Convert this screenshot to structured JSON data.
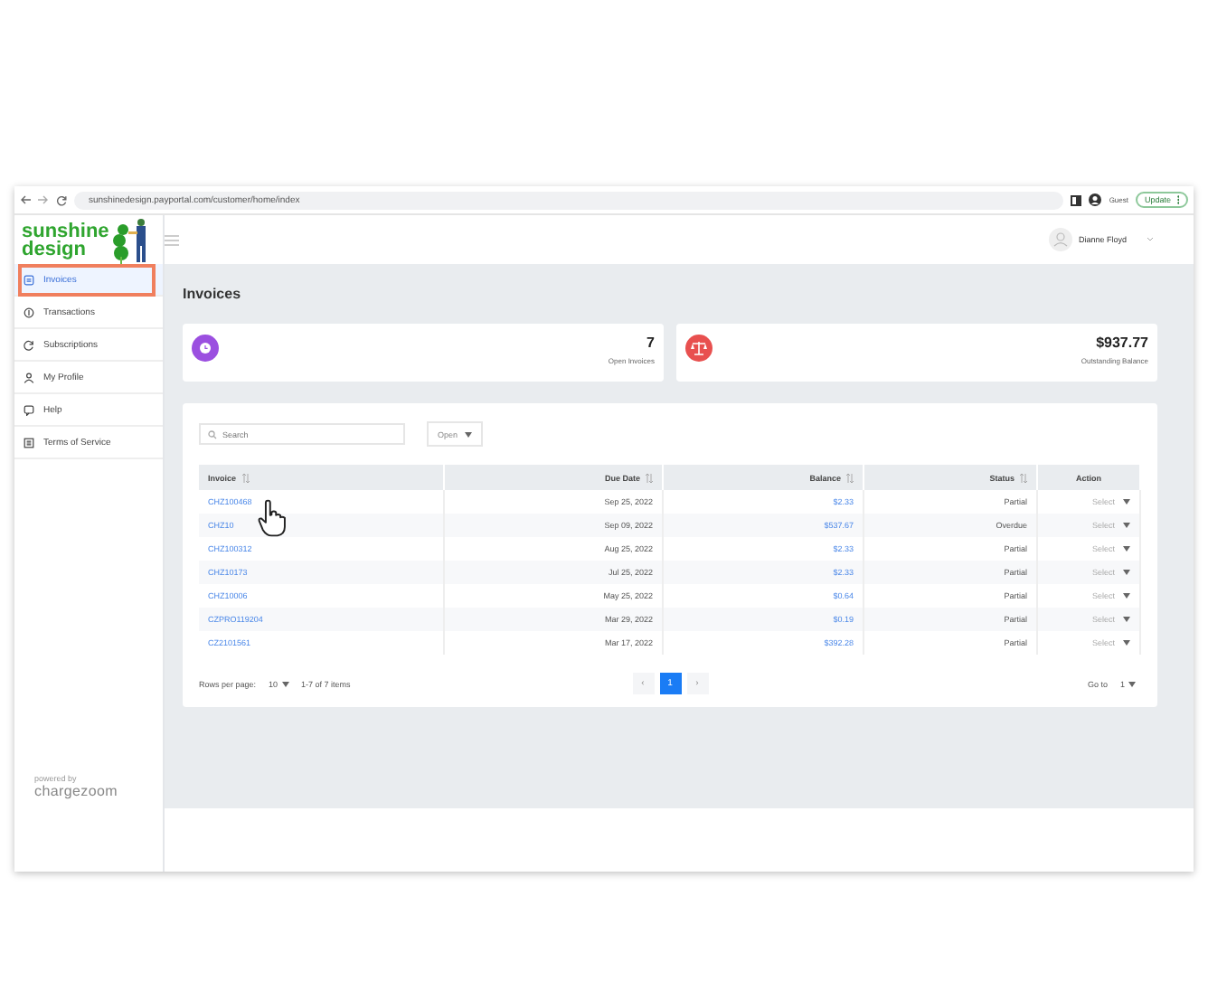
{
  "browser": {
    "url": "sunshinedesign.payportal.com/customer/home/index",
    "profile": "Guest",
    "update_button": "Update"
  },
  "logo": {
    "line1": "sunshine",
    "line2": "design"
  },
  "sidebar": {
    "items": [
      {
        "label": "Invoices",
        "selected": true
      },
      {
        "label": "Transactions",
        "selected": false
      },
      {
        "label": "Subscriptions",
        "selected": false
      },
      {
        "label": "My Profile",
        "selected": false
      },
      {
        "label": "Help",
        "selected": false
      },
      {
        "label": "Terms of Service",
        "selected": false
      }
    ],
    "powered_by": "powered by",
    "brand": "chargezoom"
  },
  "header": {
    "user": "Dianne Floyd"
  },
  "page_title": "Invoices",
  "stats": [
    {
      "value": "7",
      "label": "Open Invoices",
      "color": "#9b4fe0"
    },
    {
      "value": "$937.77",
      "label": "Outstanding Balance",
      "color": "#e8504f"
    }
  ],
  "filters": {
    "search_placeholder": "Search",
    "status": "Open"
  },
  "table": {
    "columns": [
      {
        "label": "Invoice",
        "sortable": true
      },
      {
        "label": "Due Date",
        "sortable": true
      },
      {
        "label": "Balance",
        "sortable": true
      },
      {
        "label": "Status",
        "sortable": true
      },
      {
        "label": "Action",
        "sortable": false
      }
    ],
    "rows": [
      {
        "invoice": "CHZ100468",
        "due_date": "Sep 25, 2022",
        "balance": "$2.33",
        "status": "Partial",
        "action": "Select"
      },
      {
        "invoice": "CHZ10",
        "due_date": "Sep 09, 2022",
        "balance": "$537.67",
        "status": "Overdue",
        "action": "Select"
      },
      {
        "invoice": "CHZ100312",
        "due_date": "Aug 25, 2022",
        "balance": "$2.33",
        "status": "Partial",
        "action": "Select"
      },
      {
        "invoice": "CHZ10173",
        "due_date": "Jul 25, 2022",
        "balance": "$2.33",
        "status": "Partial",
        "action": "Select"
      },
      {
        "invoice": "CHZ10006",
        "due_date": "May 25, 2022",
        "balance": "$0.64",
        "status": "Partial",
        "action": "Select"
      },
      {
        "invoice": "CZPRO119204",
        "due_date": "Mar 29, 2022",
        "balance": "$0.19",
        "status": "Partial",
        "action": "Select"
      },
      {
        "invoice": "CZ2101561",
        "due_date": "Mar 17, 2022",
        "balance": "$392.28",
        "status": "Partial",
        "action": "Select"
      }
    ]
  },
  "pagination": {
    "rows_label": "Rows per page:",
    "rows_value": "10",
    "range": "1-7 of 7 items",
    "prev": "‹",
    "pages": [
      {
        "label": "1",
        "selected": true
      }
    ],
    "next": "›",
    "goto_label": "Go to",
    "goto_value": "1"
  }
}
